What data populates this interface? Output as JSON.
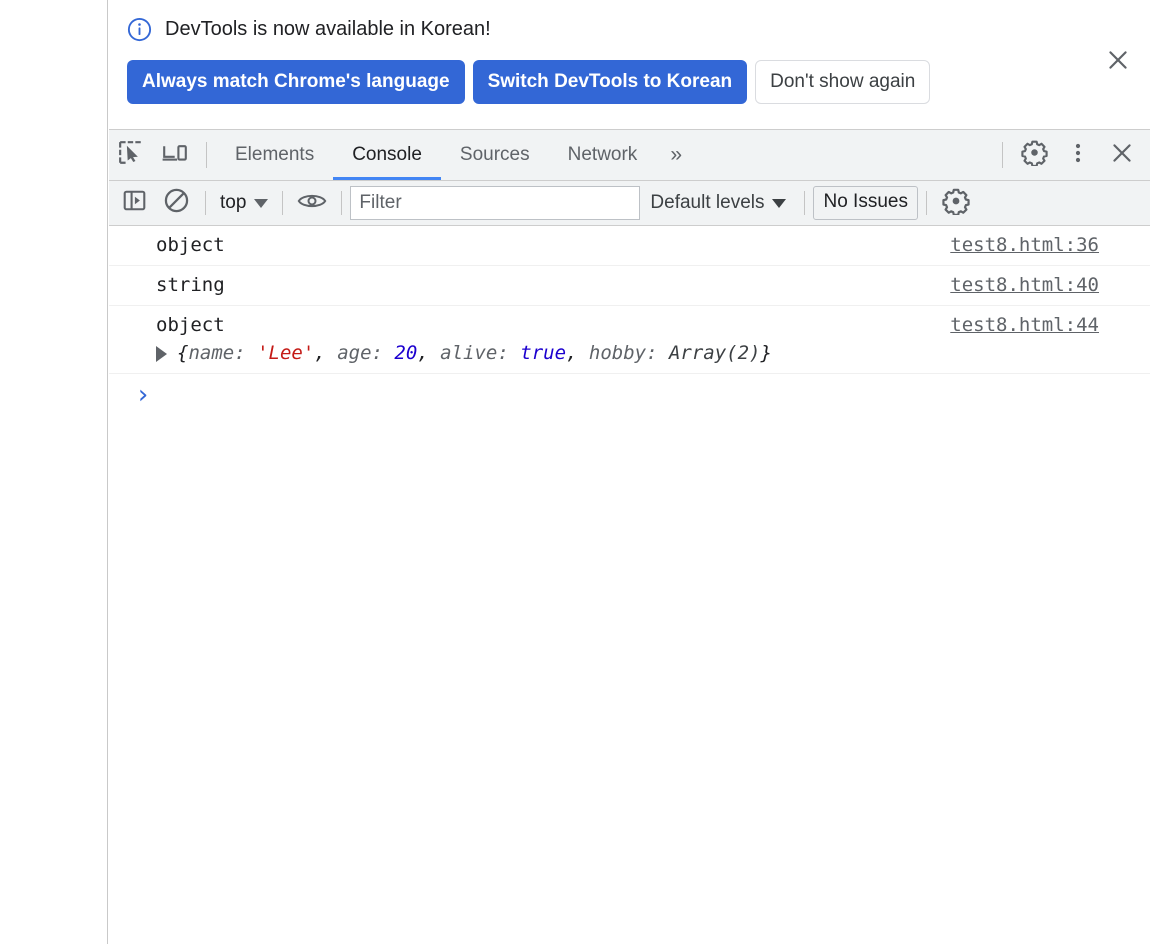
{
  "left_gutter": {
    "name": "page-area"
  },
  "banner": {
    "icon": "info-circle-icon",
    "title": "DevTools is now available in Korean!",
    "primary_button": "Always match Chrome's language",
    "secondary_button": "Switch DevTools to Korean",
    "dismiss_button": "Don't show again",
    "close_icon": "close-icon",
    "accent_color": "#3367d6"
  },
  "tabbar": {
    "inspect_icon": "inspect-element-icon",
    "device_icon": "device-toolbar-icon",
    "tabs": [
      {
        "label": "Elements",
        "active": false
      },
      {
        "label": "Console",
        "active": true
      },
      {
        "label": "Sources",
        "active": false
      },
      {
        "label": "Network",
        "active": false
      }
    ],
    "more_tabs": "»",
    "settings_icon": "gear-icon",
    "menu_icon": "kebab-menu-icon",
    "close_icon": "close-icon",
    "active_underline_color": "#4285f4"
  },
  "console_toolbar": {
    "sidebar_icon": "console-sidebar-icon",
    "clear_icon": "clear-console-icon",
    "context_selector": "top",
    "eye_icon": "live-expression-icon",
    "filter_placeholder": "Filter",
    "filter_value": "",
    "levels_label": "Default levels",
    "issues_label": "No Issues",
    "settings_icon": "gear-icon"
  },
  "console_messages": [
    {
      "text": "object",
      "source": "test8.html:36",
      "preview": null
    },
    {
      "text": "string",
      "source": "test8.html:40",
      "preview": null
    },
    {
      "text": "object",
      "source": "test8.html:44",
      "preview": {
        "open": "{",
        "tokens": [
          {
            "t": "name: ",
            "k": "key"
          },
          {
            "t": "'Lee'",
            "k": "str"
          },
          {
            "t": ", ",
            "k": "punct"
          },
          {
            "t": "age: ",
            "k": "key"
          },
          {
            "t": "20",
            "k": "num"
          },
          {
            "t": ", ",
            "k": "punct"
          },
          {
            "t": "alive: ",
            "k": "key"
          },
          {
            "t": "true",
            "k": "bool"
          },
          {
            "t": ", ",
            "k": "punct"
          },
          {
            "t": "hobby: ",
            "k": "key"
          },
          {
            "t": "Array(2)",
            "k": "sub"
          }
        ],
        "close": "}"
      }
    }
  ],
  "prompt": {
    "chevron": "›",
    "value": "",
    "color": "#3367d6"
  }
}
